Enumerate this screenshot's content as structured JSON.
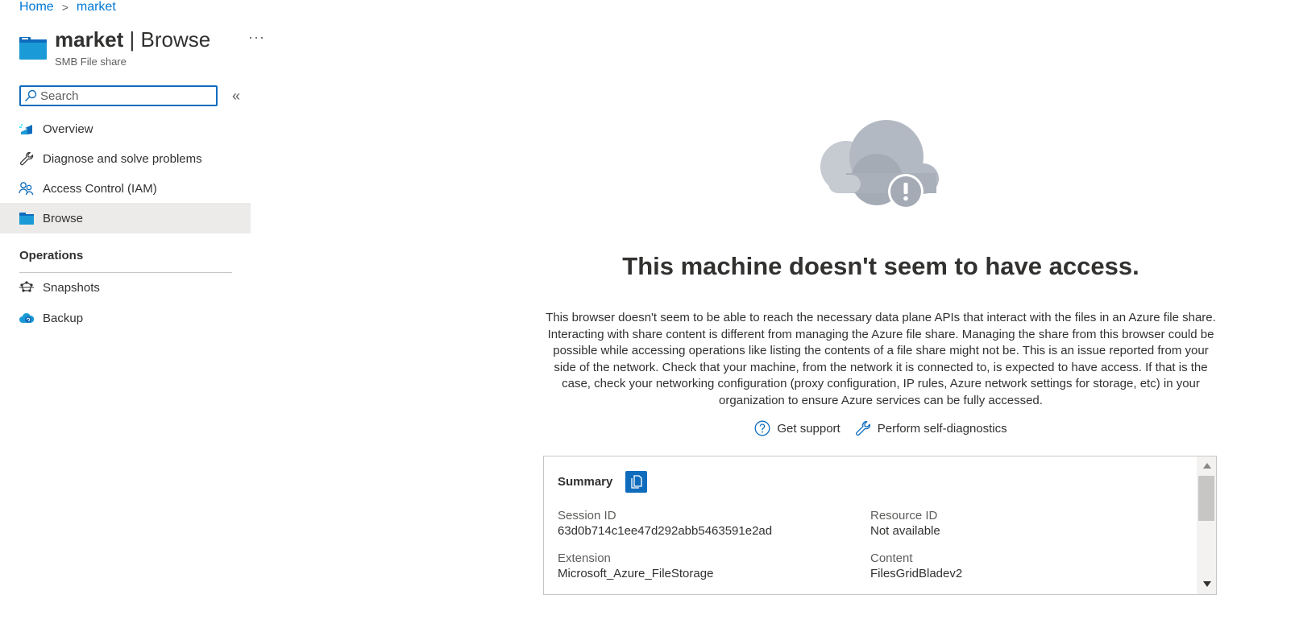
{
  "breadcrumb": {
    "home": "Home",
    "current": "market",
    "separator": ">"
  },
  "header": {
    "name": "market",
    "divider": "|",
    "page": "Browse",
    "subtitle": "SMB File share",
    "more": "···",
    "icon": "folder-icon"
  },
  "search": {
    "placeholder": "Search",
    "value": ""
  },
  "collapse_label": "«",
  "nav": {
    "items": [
      {
        "label": "Overview",
        "icon": "overview-icon"
      },
      {
        "label": "Diagnose and solve problems",
        "icon": "wrench-icon"
      },
      {
        "label": "Access Control (IAM)",
        "icon": "people-icon"
      },
      {
        "label": "Browse",
        "icon": "folder-icon",
        "active": true
      }
    ],
    "section": "Operations",
    "section_items": [
      {
        "label": "Snapshots",
        "icon": "snapshots-icon"
      },
      {
        "label": "Backup",
        "icon": "backup-icon"
      }
    ]
  },
  "main": {
    "heading": "This machine doesn't seem to have access.",
    "description": "This browser doesn't seem to be able to reach the necessary data plane APIs that interact with the files in an Azure file share. Interacting with share content is different from managing the Azure file share. Managing the share from this browser could be possible while accessing operations like listing the contents of a file share might not be. This is an issue reported from your side of the network. Check that your machine, from the network it is connected to, is expected to have access. If that is the case, check your networking configuration (proxy configuration, IP rules, Azure network settings for storage, etc) in your organization to ensure Azure services can be fully accessed.",
    "actions": {
      "support": "Get support",
      "diagnostics": "Perform self-diagnostics"
    }
  },
  "summary": {
    "title": "Summary",
    "session_id_label": "Session ID",
    "session_id": "63d0b714c1ee47d292abb5463591e2ad",
    "resource_id_label": "Resource ID",
    "resource_id": "Not available",
    "extension_label": "Extension",
    "extension": "Microsoft_Azure_FileStorage",
    "content_label": "Content",
    "content": "FilesGridBladev2"
  },
  "colors": {
    "accent": "#0078d4",
    "active_bg": "#edebe9",
    "cloud": "#a9b0ba"
  }
}
